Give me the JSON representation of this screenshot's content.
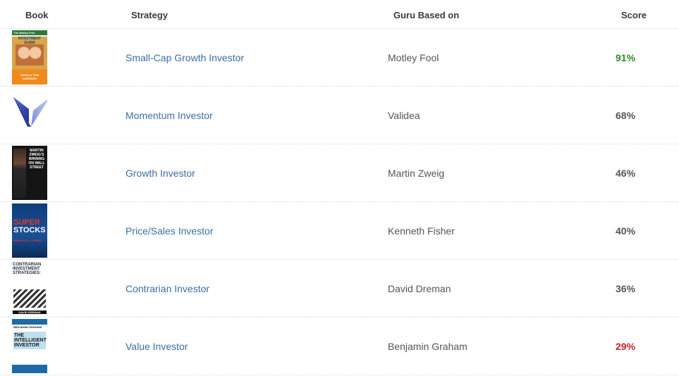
{
  "header": {
    "book": "Book",
    "strategy": "Strategy",
    "guru": "Guru Based on",
    "score": "Score"
  },
  "rows": [
    {
      "strategy": "Small-Cap Growth Investor",
      "guru": "Motley Fool",
      "score": "91%",
      "score_color": "#2e8b2e",
      "cover": {
        "top": "The Motley Fool",
        "title": "INVESTMENT GUIDE",
        "author": "DAVID & TOM GARDNER"
      }
    },
    {
      "strategy": "Momentum Investor",
      "guru": "Validea",
      "score": "68%",
      "score_color": "#555555",
      "cover": {
        "icon": "validea-logo-icon"
      }
    },
    {
      "strategy": "Growth Investor",
      "guru": "Martin Zweig",
      "score": "46%",
      "score_color": "#555555",
      "cover": {
        "title": "MARTIN ZWEIG'S WINNING ON WALL STREET"
      }
    },
    {
      "strategy": "Price/Sales Investor",
      "guru": "Kenneth Fisher",
      "score": "40%",
      "score_color": "#555555",
      "cover": {
        "title1": "SUPER",
        "title2": "STOCKS",
        "author": "KENNETH L. FISHER"
      }
    },
    {
      "strategy": "Contrarian Investor",
      "guru": "David Dreman",
      "score": "36%",
      "score_color": "#555555",
      "cover": {
        "title": "CONTRARIAN INVESTMENT STRATEGIES:",
        "author": "DAVID DREMAN"
      }
    },
    {
      "strategy": "Value Investor",
      "guru": "Benjamin Graham",
      "score": "29%",
      "score_color": "#cc2222",
      "cover": {
        "author": "BENJAMIN GRAHAM",
        "title": "THE INTELLIGENT INVESTOR"
      }
    }
  ]
}
